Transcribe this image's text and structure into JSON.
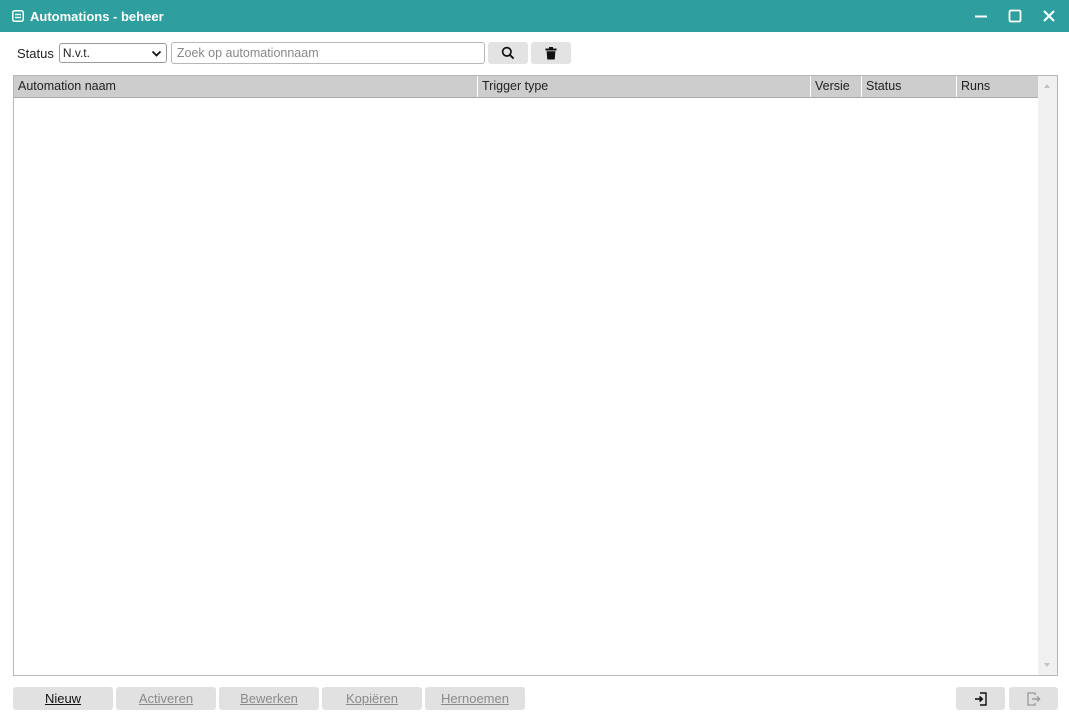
{
  "window": {
    "title": "Automations - beheer",
    "accent": "#2e9e9e"
  },
  "filter": {
    "status_label": "Status",
    "status_value": "N.v.t.",
    "search_placeholder": "Zoek op automationnaam",
    "search_value": ""
  },
  "table": {
    "columns": [
      "Automation naam",
      "Trigger type",
      "Versie",
      "Status",
      "Runs"
    ],
    "rows": []
  },
  "actions": {
    "new": "Nieuw",
    "activate": "Activeren",
    "edit": "Bewerken",
    "copy": "Kopiëren",
    "rename": "Hernoemen"
  },
  "icons": {
    "title": "window-icon",
    "search": "search-icon",
    "clear": "trash-icon",
    "import": "import-icon",
    "exit": "exit-icon"
  }
}
